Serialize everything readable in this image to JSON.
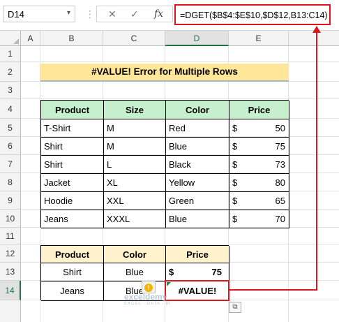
{
  "formula_bar": {
    "name_box": "D14",
    "name_box_dropdown": "▾",
    "separator": "⋮",
    "cancel": "✕",
    "enter": "✓",
    "fx": "fx",
    "formula": "=DGET($B$4:$E$10,$D$12,B13:C14)"
  },
  "columns": [
    "A",
    "B",
    "C",
    "D",
    "E"
  ],
  "selected_column": "D",
  "rows": [
    "1",
    "2",
    "3",
    "4",
    "5",
    "6",
    "7",
    "8",
    "9",
    "10",
    "11",
    "12",
    "13",
    "14"
  ],
  "selected_row": "14",
  "title": "#VALUE! Error for Multiple Rows",
  "main_table": {
    "headers": [
      "Product",
      "Size",
      "Color",
      "Price"
    ],
    "currency": "$",
    "rows": [
      [
        "T-Shirt",
        "M",
        "Red",
        "50"
      ],
      [
        "Shirt",
        "M",
        "Blue",
        "75"
      ],
      [
        "Shirt",
        "L",
        "Black",
        "73"
      ],
      [
        "Jacket",
        "XL",
        "Yellow",
        "80"
      ],
      [
        "Hoodie",
        "XXL",
        "Green",
        "65"
      ],
      [
        "Jeans",
        "XXXL",
        "Blue",
        "70"
      ]
    ]
  },
  "criteria_table": {
    "headers": [
      "Product",
      "Color",
      "Price"
    ],
    "rows": [
      [
        "Shirt",
        "Blue",
        "75"
      ],
      [
        "Jeans",
        "Blue",
        "#VALUE!"
      ]
    ],
    "currency": "$"
  },
  "watermark": {
    "brand": "exceldemy",
    "tagline": "EXCEL · DATA · BI"
  },
  "colors": {
    "header_green": "#c6efce",
    "header_yellow": "#fff2cc",
    "title_fill": "#ffe699",
    "highlight_red": "#e0161e",
    "excel_green": "#217346"
  },
  "icons": {
    "warning": "!",
    "paste_options": "⧉"
  }
}
